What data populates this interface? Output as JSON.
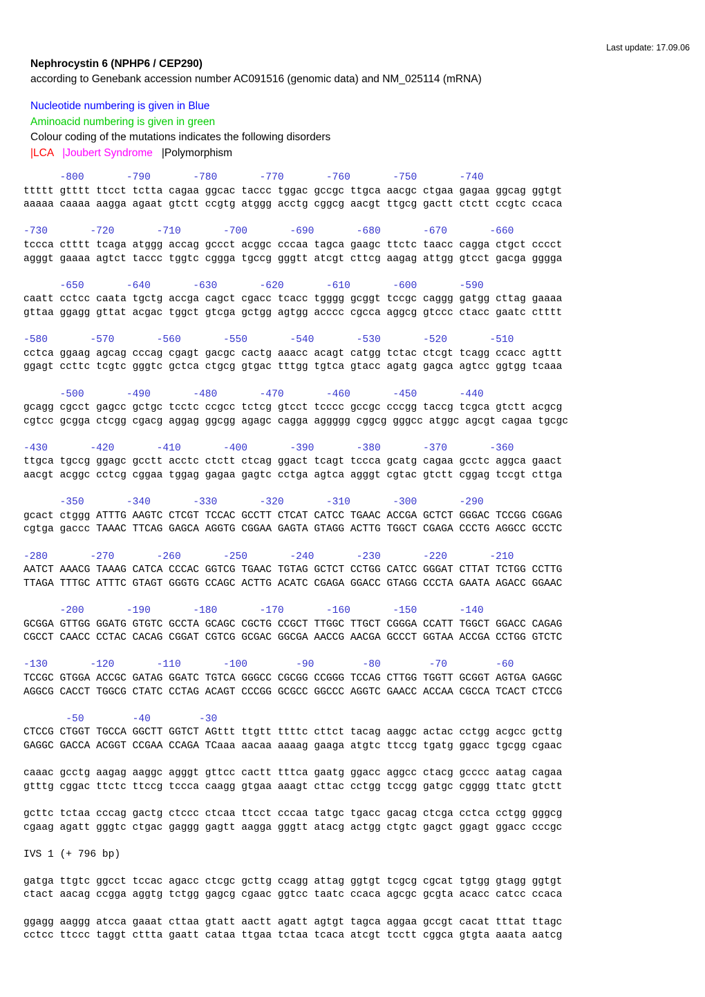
{
  "meta": {
    "last_update": "Last update: 17.09.06"
  },
  "header": {
    "title": "Nephrocystin 6 (NPHP6 / CEP290)",
    "subtitle": "according to Genebank accession number AC091516 (genomic data) and NM_025114 (mRNA)"
  },
  "legend": {
    "nucleotide_line": "Nucleotide numbering is given in Blue",
    "aminoacid_line": "Aminoacid numbering is given in green",
    "colour_coding_line": "Colour coding of the mutations indicates the following disorders",
    "key_lca": "|LCA",
    "key_joubert": "|Joubert Syndrome",
    "key_polymorphism": "|Polymorphism",
    "colors": {
      "nucleotide": "#0000ff",
      "aminoacid": "#00cc00",
      "lca": "#ff0000",
      "joubert": "#ff00ff",
      "polymorphism": "#000000"
    }
  },
  "sequence": {
    "blocks": [
      {
        "numbers": "      -800       -790       -780       -770       -760       -750       -740",
        "top": "ttttt gtttt ttcct tctta cagaa ggcac taccc tggac gccgc ttgca aacgc ctgaa gagaa ggcag ggtgt",
        "bottom": "aaaaa caaaa aagga agaat gtctt ccgtg atggg acctg cggcg aacgt ttgcg gactt ctctt ccgtc ccaca"
      },
      {
        "numbers": "-730       -720       -710       -700       -690       -680       -670       -660",
        "top": "tccca ctttt tcaga atggg accag gccct acggc cccaa tagca gaagc ttctc taacc cagga ctgct cccct",
        "bottom": "agggt gaaaa agtct taccc tggtc cggga tgccg gggtt atcgt cttcg aagag attgg gtcct gacga gggga"
      },
      {
        "numbers": "      -650       -640       -630       -620       -610       -600       -590",
        "top": "caatt cctcc caata tgctg accga cagct cgacc tcacc tgggg gcggt tccgc caggg gatgg cttag gaaaa",
        "bottom": "gttaa ggagg gttat acgac tggct gtcga gctgg agtgg acccc cgcca aggcg gtccc ctacc gaatc ctttt"
      },
      {
        "numbers": "-580       -570       -560       -550       -540       -530       -520       -510",
        "top": "cctca ggaag agcag cccag cgagt gacgc cactg aaacc acagt catgg tctac ctcgt tcagg ccacc agttt",
        "bottom": "ggagt ccttc tcgtc gggtc gctca ctgcg gtgac tttgg tgtca gtacc agatg gagca agtcc ggtgg tcaaa"
      },
      {
        "numbers": "      -500       -490       -480       -470       -460       -450       -440",
        "top": "gcagg cgcct gagcc gctgc tcctc ccgcc tctcg gtcct tcccc gccgc cccgg taccg tcgca gtctt acgcg",
        "bottom": "cgtcc gcgga ctcgg cgacg aggag ggcgg agagc cagga aggggg cggcg gggcc atggc agcgt cagaa tgcgc"
      },
      {
        "numbers": "-430       -420       -410       -400       -390       -380       -370       -360",
        "top": "ttgca tgccg ggagc gcctt acctc ctctt ctcag ggact tcagt tccca gcatg cagaa gcctc aggca gaact",
        "bottom": "aacgt acggc cctcg cggaa tggag gagaa gagtc cctga agtca agggt cgtac gtctt cggag tccgt cttga"
      },
      {
        "numbers": "      -350       -340       -330       -320       -310       -300       -290",
        "top": "gcact ctggg ATTTG AAGTC CTCGT TCCAC GCCTT CTCAT CATCC TGAAC ACCGA GCTCT GGGAC TCCGG CGGAG",
        "bottom": "cgtga gaccc TAAAC TTCAG GAGCA AGGTG CGGAA GAGTA GTAGG ACTTG TGGCT CGAGA CCCTG AGGCC GCCTC"
      },
      {
        "numbers": "-280       -270       -260       -250       -240       -230       -220       -210",
        "top": "AATCT AAACG TAAAG CATCA CCCAC GGTCG TGAAC TGTAG GCTCT CCTGG CATCC GGGAT CTTAT TCTGG CCTTG",
        "bottom": "TTAGA TTTGC ATTTC GTAGT GGGTG CCAGC ACTTG ACATC CGAGA GGACC GTAGG CCCTA GAATA AGACC GGAAC"
      },
      {
        "numbers": "      -200       -190       -180       -170       -160       -150       -140",
        "top": "GCGGA GTTGG GGATG GTGTC GCCTA GCAGC CGCTG CCGCT TTGGC TTGCT CGGGA CCATT TGGCT GGACC CAGAG",
        "bottom": "CGCCT CAACC CCTAC CACAG CGGAT CGTCG GCGAC GGCGA AACCG AACGA GCCCT GGTAA ACCGA CCTGG GTCTC"
      },
      {
        "numbers": "-130       -120       -110       -100        -90        -80        -70        -60",
        "top": "TCCGC GTGGA ACCGC GATAG GGATC TGTCA GGGCC CGCGG CCGGG TCCAG CTTGG TGGTT GCGGT AGTGA GAGGC",
        "bottom": "AGGCG CACCT TGGCG CTATC CCTAG ACAGT CCCGG GCGCC GGCCC AGGTC GAACC ACCAA CGCCA TCACT CTCCG"
      },
      {
        "numbers": "       -50        -40        -30",
        "top": "CTCCG CTGGT TGCCA GGCTT GGTCT AGttt ttgtt ttttc cttct tacag aaggc actac cctgg acgcc gcttg",
        "bottom": "GAGGC GACCA ACGGT CCGAA CCAGA TCaaa aacaa aaaag gaaga atgtc ttccg tgatg ggacc tgcgg cgaac"
      },
      {
        "numbers": "",
        "top": "caaac gcctg aagag aaggc agggt gttcc cactt tttca gaatg ggacc aggcc ctacg gcccc aatag cagaa",
        "bottom": "gtttg cggac ttctc ttccg tccca caagg gtgaa aaagt cttac cctgg tccgg gatgc cgggg ttatc gtctt"
      },
      {
        "numbers": "",
        "top": "gcttc tctaa cccag gactg ctccc ctcaa ttcct cccaa tatgc tgacc gacag ctcga cctca cctgg gggcg",
        "bottom": "cgaag agatt gggtc ctgac gaggg gagtt aagga gggtt atacg actgg ctgtc gagct ggagt ggacc cccgc"
      }
    ],
    "ivs_label": "IVS 1 (+ 796 bp)",
    "post_ivs_blocks": [
      {
        "top": "gatga ttgtc ggcct tccac agacc ctcgc gcttg ccagg attag ggtgt tcgcg cgcat tgtgg gtagg ggtgt",
        "bottom": "ctact aacag ccgga aggtg tctgg gagcg cgaac ggtcc taatc ccaca agcgc gcgta acacc catcc ccaca"
      },
      {
        "top": "ggagg aaggg atcca gaaat cttaa gtatt aactt agatt agtgt tagca aggaa gccgt cacat tttat ttagc",
        "bottom": "cctcc ttccc taggt cttta gaatt cataa ttgaa tctaa tcaca atcgt tcctt cggca gtgta aaata aatcg"
      }
    ]
  }
}
